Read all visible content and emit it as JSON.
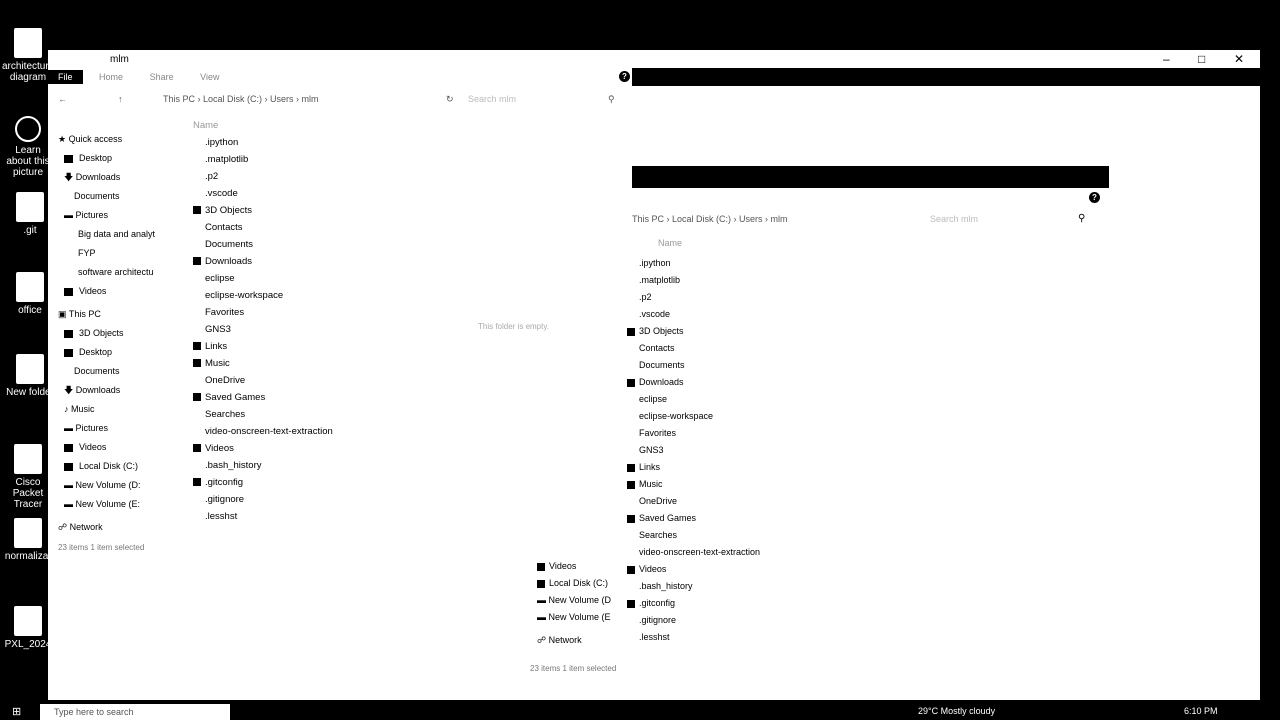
{
  "desktop_icons": [
    {
      "label": "architecture diagram",
      "icon": "file-icon"
    },
    {
      "label": "Learn about this picture",
      "icon": "info-icon"
    },
    {
      "label": ".git",
      "icon": "folder-icon"
    },
    {
      "label": "office",
      "icon": "file-icon"
    },
    {
      "label": "New folder",
      "icon": "folder-icon"
    },
    {
      "label": "Cisco Packet Tracer",
      "icon": "app-icon"
    },
    {
      "label": "normalizat",
      "icon": "file-icon"
    },
    {
      "label": "PXL_2024",
      "icon": "image-icon"
    }
  ],
  "window": {
    "title": "mlm",
    "ribbon_tabs": [
      "File",
      "Home",
      "Share",
      "View"
    ],
    "breadcrumb": [
      "This PC",
      "Local Disk (C:)",
      "Users",
      "mlm"
    ],
    "search_placeholder": "Search mlm",
    "help_label": "?",
    "nav": {
      "quick_access_label": "Quick access",
      "quick_access": [
        "Desktop",
        "Downloads",
        "Documents",
        "Pictures",
        "Big data and analyt",
        "FYP",
        "software architectu",
        "Videos"
      ],
      "this_pc_label": "This PC",
      "this_pc": [
        "3D Objects",
        "Desktop",
        "Documents",
        "Downloads",
        "Music",
        "Pictures",
        "Videos",
        "Local Disk (C:)",
        "New Volume (D:",
        "New Volume (E:"
      ],
      "network_label": "Network"
    },
    "column_name": "Name",
    "files": [
      ".ipython",
      ".matplotlib",
      ".p2",
      ".vscode",
      "3D Objects",
      "Contacts",
      "Documents",
      "Downloads",
      "eclipse",
      "eclipse-workspace",
      "Favorites",
      "GNS3",
      "Links",
      "Music",
      "OneDrive",
      "Saved Games",
      "Searches",
      "video-onscreen-text-extraction",
      "Videos",
      ".bash_history",
      ".gitconfig",
      ".gitignore",
      ".lesshst"
    ],
    "status_text": "23 items    1 item selected",
    "empty_hint": "This folder is empty."
  },
  "overlay": {
    "breadcrumb": [
      "This PC",
      "Local Disk (C:)",
      "Users",
      "mlm"
    ],
    "search_placeholder": "Search mlm",
    "column_name": "Name",
    "files": [
      ".ipython",
      ".matplotlib",
      ".p2",
      ".vscode",
      "3D Objects",
      "Contacts",
      "Documents",
      "Downloads",
      "eclipse",
      "eclipse-workspace",
      "Favorites",
      "GNS3",
      "Links",
      "Music",
      "OneDrive",
      "Saved Games",
      "Searches",
      "video-onscreen-text-extraction",
      "Videos",
      ".bash_history",
      ".gitconfig",
      ".gitignore",
      ".lesshst"
    ],
    "nav_items": [
      "Videos",
      "Local Disk (C:)",
      "New Volume (D",
      "New Volume (E"
    ],
    "network_label": "Network",
    "status_text": "23 items    1 item selected"
  },
  "taskbar": {
    "search_placeholder": "Type here to search",
    "weather": "29°C  Mostly cloudy",
    "time": "6:10 PM"
  }
}
